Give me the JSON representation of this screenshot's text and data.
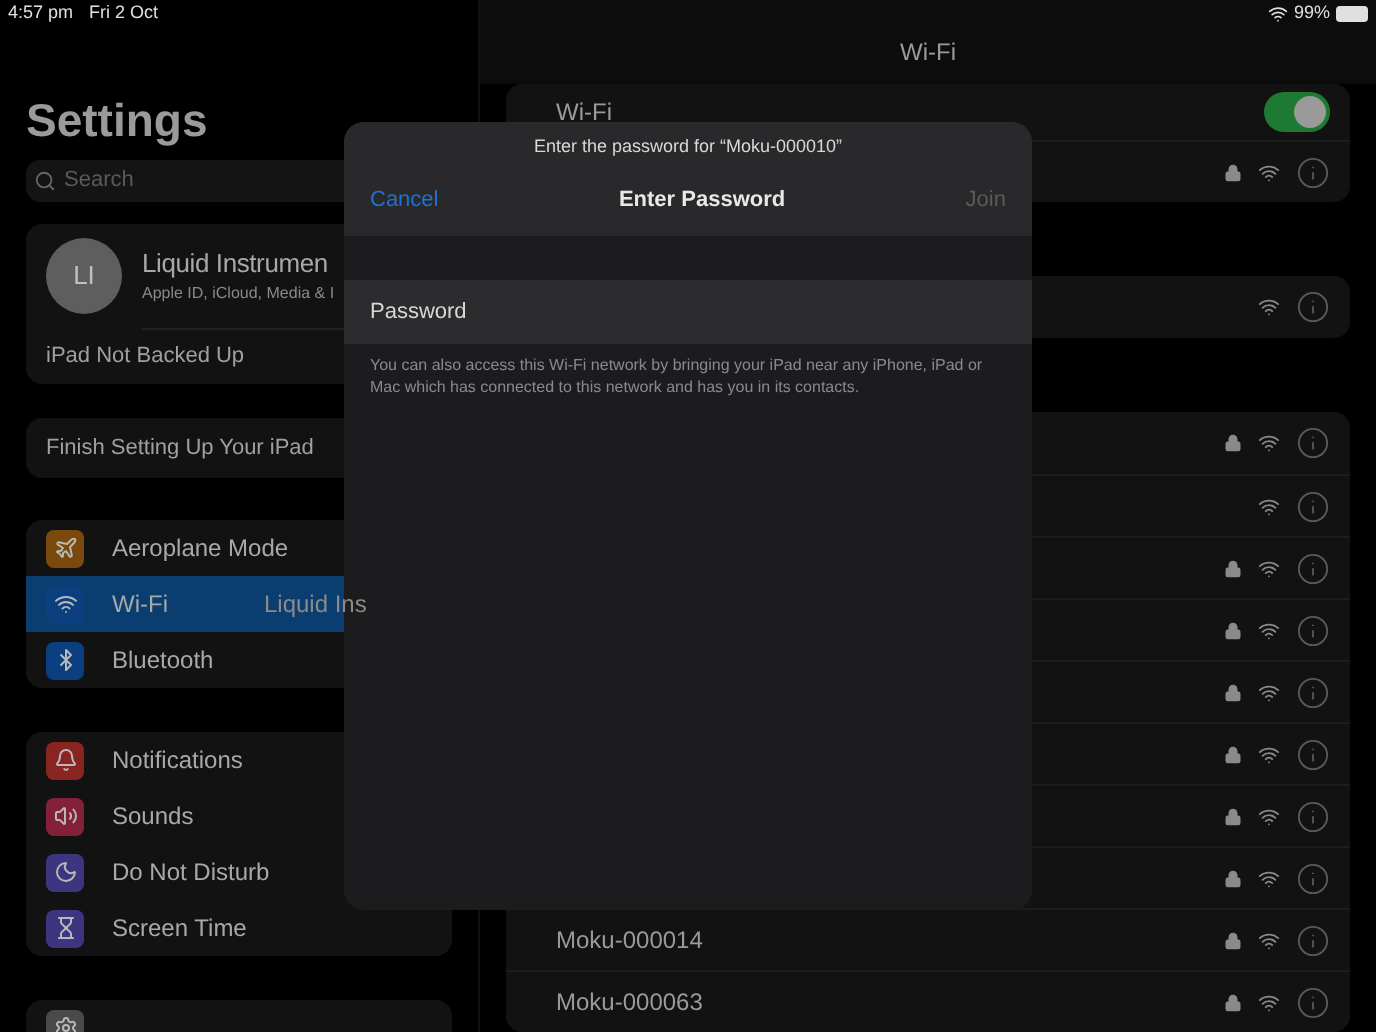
{
  "status_bar": {
    "time": "4:57 pm",
    "date": "Fri 2 Oct",
    "battery": "99%"
  },
  "sidebar": {
    "title": "Settings",
    "search": {
      "placeholder": "Search"
    },
    "profile": {
      "initials": "LI",
      "name": "Liquid Instrumen",
      "subtitle": "Apple ID, iCloud, Media & I",
      "backup": "iPad Not Backed Up"
    },
    "setup": "Finish Setting Up Your iPad",
    "groups": [
      [
        {
          "kind": "airplane",
          "label": "Aeroplane Mode",
          "color": "#7a4a0c",
          "selected": false
        },
        {
          "kind": "wifi",
          "label": "Wi-Fi",
          "value": "Liquid Ins",
          "color": "#0b3f80",
          "selected": true
        },
        {
          "kind": "bluetooth",
          "label": "Bluetooth",
          "color": "#0b3f80",
          "selected": false
        }
      ],
      [
        {
          "kind": "notifications",
          "label": "Notifications",
          "color": "#8a2421",
          "selected": false
        },
        {
          "kind": "sounds",
          "label": "Sounds",
          "color": "#85203a",
          "selected": false
        },
        {
          "kind": "moon",
          "label": "Do Not Disturb",
          "color": "#3e3580",
          "selected": false
        },
        {
          "kind": "hourglass",
          "label": "Screen Time",
          "color": "#3e3580",
          "selected": false
        }
      ],
      [
        {
          "kind": "gear",
          "color": "#4a4a4c",
          "selected": false
        }
      ]
    ]
  },
  "detail": {
    "title": "Wi-Fi",
    "toggle": {
      "label": "Wi-Fi",
      "on": true
    },
    "groups": [
      [
        {
          "locked": true
        }
      ],
      [
        {
          "locked": false
        }
      ],
      [
        {
          "locked": true
        },
        {
          "locked": false
        },
        {
          "locked": true
        },
        {
          "locked": true
        },
        {
          "locked": true
        },
        {
          "locked": true
        },
        {
          "locked": true
        },
        {
          "locked": true
        },
        {
          "name": "Moku-000014",
          "locked": true
        },
        {
          "name": "Moku-000063",
          "locked": true
        }
      ]
    ]
  },
  "dialog": {
    "prompt": "Enter the password for “Moku-000010”",
    "cancel": "Cancel",
    "title": "Enter Password",
    "join": {
      "label": "Join",
      "disabled": true
    },
    "field": {
      "placeholder": "Password"
    },
    "note": "You can also access this Wi-Fi network by bringing your iPad near any iPhone, iPad or Mac which has connected to this network and has you in its contacts."
  }
}
